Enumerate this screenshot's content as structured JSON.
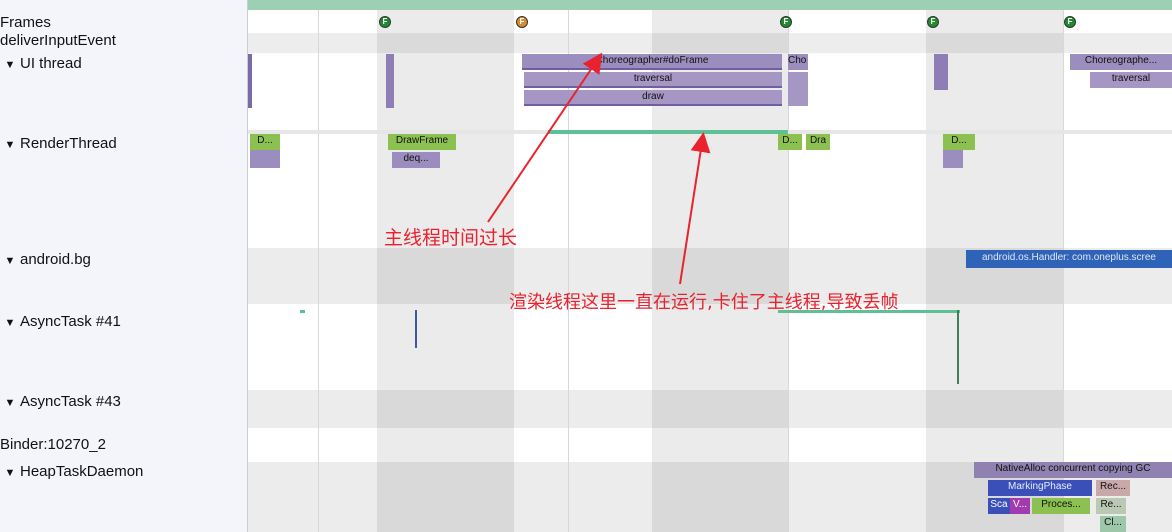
{
  "tracks": [
    {
      "label": "Frames",
      "expandable": false
    },
    {
      "label": "deliverInputEvent",
      "expandable": false
    },
    {
      "label": "UI thread",
      "expandable": true
    },
    {
      "label": "RenderThread",
      "expandable": true
    },
    {
      "label": "android.bg",
      "expandable": true
    },
    {
      "label": "AsyncTask #41",
      "expandable": true
    },
    {
      "label": "AsyncTask #43",
      "expandable": true
    },
    {
      "label": "Binder:10270_2",
      "expandable": false
    },
    {
      "label": "HeapTaskDaemon",
      "expandable": true
    }
  ],
  "expand_glyph": "▼",
  "frame_markers": [
    {
      "label": "F",
      "color": "#1f8a2e"
    },
    {
      "label": "F",
      "color": "#d98a2b"
    },
    {
      "label": "F",
      "color": "#1f8a2e"
    },
    {
      "label": "F",
      "color": "#1f8a2e"
    },
    {
      "label": "F",
      "color": "#1f8a2e"
    }
  ],
  "slices": {
    "choreographer_do_frame": "Choreographer#doFrame",
    "traversal": "traversal",
    "draw": "draw",
    "cho": "Cho",
    "choreographe": "Choreographe...",
    "traversal2": "traversal",
    "d1": "D...",
    "draw_frame": "DrawFrame",
    "deq": "deq...",
    "d2": "D...",
    "dra": "Dra",
    "d3": "D...",
    "android_handler": "android.os.Handler: com.oneplus.scree",
    "native_alloc": "NativeAlloc concurrent copying GC",
    "marking_phase": "MarkingPhase",
    "rec": "Rec...",
    "sca": "Sca",
    "v": "V...",
    "proces": "Proces...",
    "re": "Re...",
    "cl": "Cl..."
  },
  "annotations": {
    "main_thread": "主线程时间过长",
    "render_thread": "渲染线程这里一直在运行,卡住了主线程,导致丢帧"
  },
  "colors": {
    "annotation": "#e8232f",
    "purple_slice": "#9b8dbd",
    "green_slice": "#8cc152",
    "teal": "#5fbf95",
    "blue_handler": "#2e63b8"
  }
}
